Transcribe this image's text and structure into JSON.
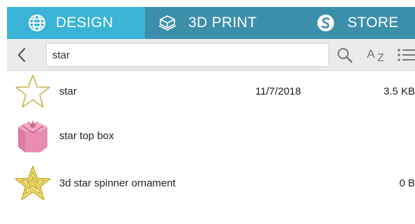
{
  "tabs": [
    {
      "label": "DESIGN",
      "icon": "globe-icon",
      "active": true
    },
    {
      "label": "3D PRINT",
      "icon": "3d-print-icon",
      "active": false
    },
    {
      "label": "STORE",
      "icon": "store-logo-icon",
      "active": false
    }
  ],
  "colors": {
    "active_tab": "#3ab3d6",
    "inactive_tab": "#3b8fab",
    "toolbar_bg": "#e9ebed"
  },
  "search": {
    "value": "star",
    "sort_label_big": "A",
    "sort_label_small": "Z"
  },
  "files": [
    {
      "name": "star",
      "date": "11/7/2018",
      "size": "3.5 KB",
      "thumb": "star-outline"
    },
    {
      "name": "star top box",
      "date": "",
      "size": "",
      "thumb": "pink-box"
    },
    {
      "name": "3d star spinner ornament",
      "date": "",
      "size": "0 B",
      "thumb": "gold-star"
    }
  ]
}
